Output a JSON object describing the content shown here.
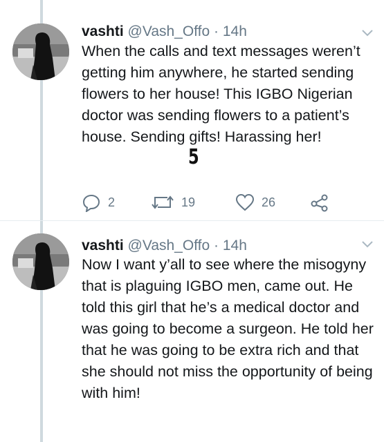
{
  "tweets": [
    {
      "author_name": "vashti",
      "handle": "@Vash_Offo",
      "separator": "·",
      "time": "14h",
      "text": "When the calls and text messages weren’t getting him anywhere, he started sending flowers to her house! This IGBO Nigerian doctor was sending flowers to a patient’s house. Sending gifts! Harassing her!",
      "overlay_mark": "5",
      "replies": "2",
      "retweets": "19",
      "likes": "26"
    },
    {
      "author_name": "vashti",
      "handle": "@Vash_Offo",
      "separator": "·",
      "time": "14h",
      "text": "Now I want y’all to see where the misogyny that is plaguing IGBO men, came out. He told this girl that he’s a medical doctor and was going to become a surgeon. He told her that he was going to be extra rich and that she should not miss the opportunity of being with him!"
    }
  ],
  "icons": {
    "caret": "chevron-down-icon",
    "reply": "reply-icon",
    "retweet": "retweet-icon",
    "like": "heart-icon",
    "share": "share-icon"
  },
  "colors": {
    "text": "#14171a",
    "secondary": "#657786",
    "thread_line": "#cfd9de"
  }
}
